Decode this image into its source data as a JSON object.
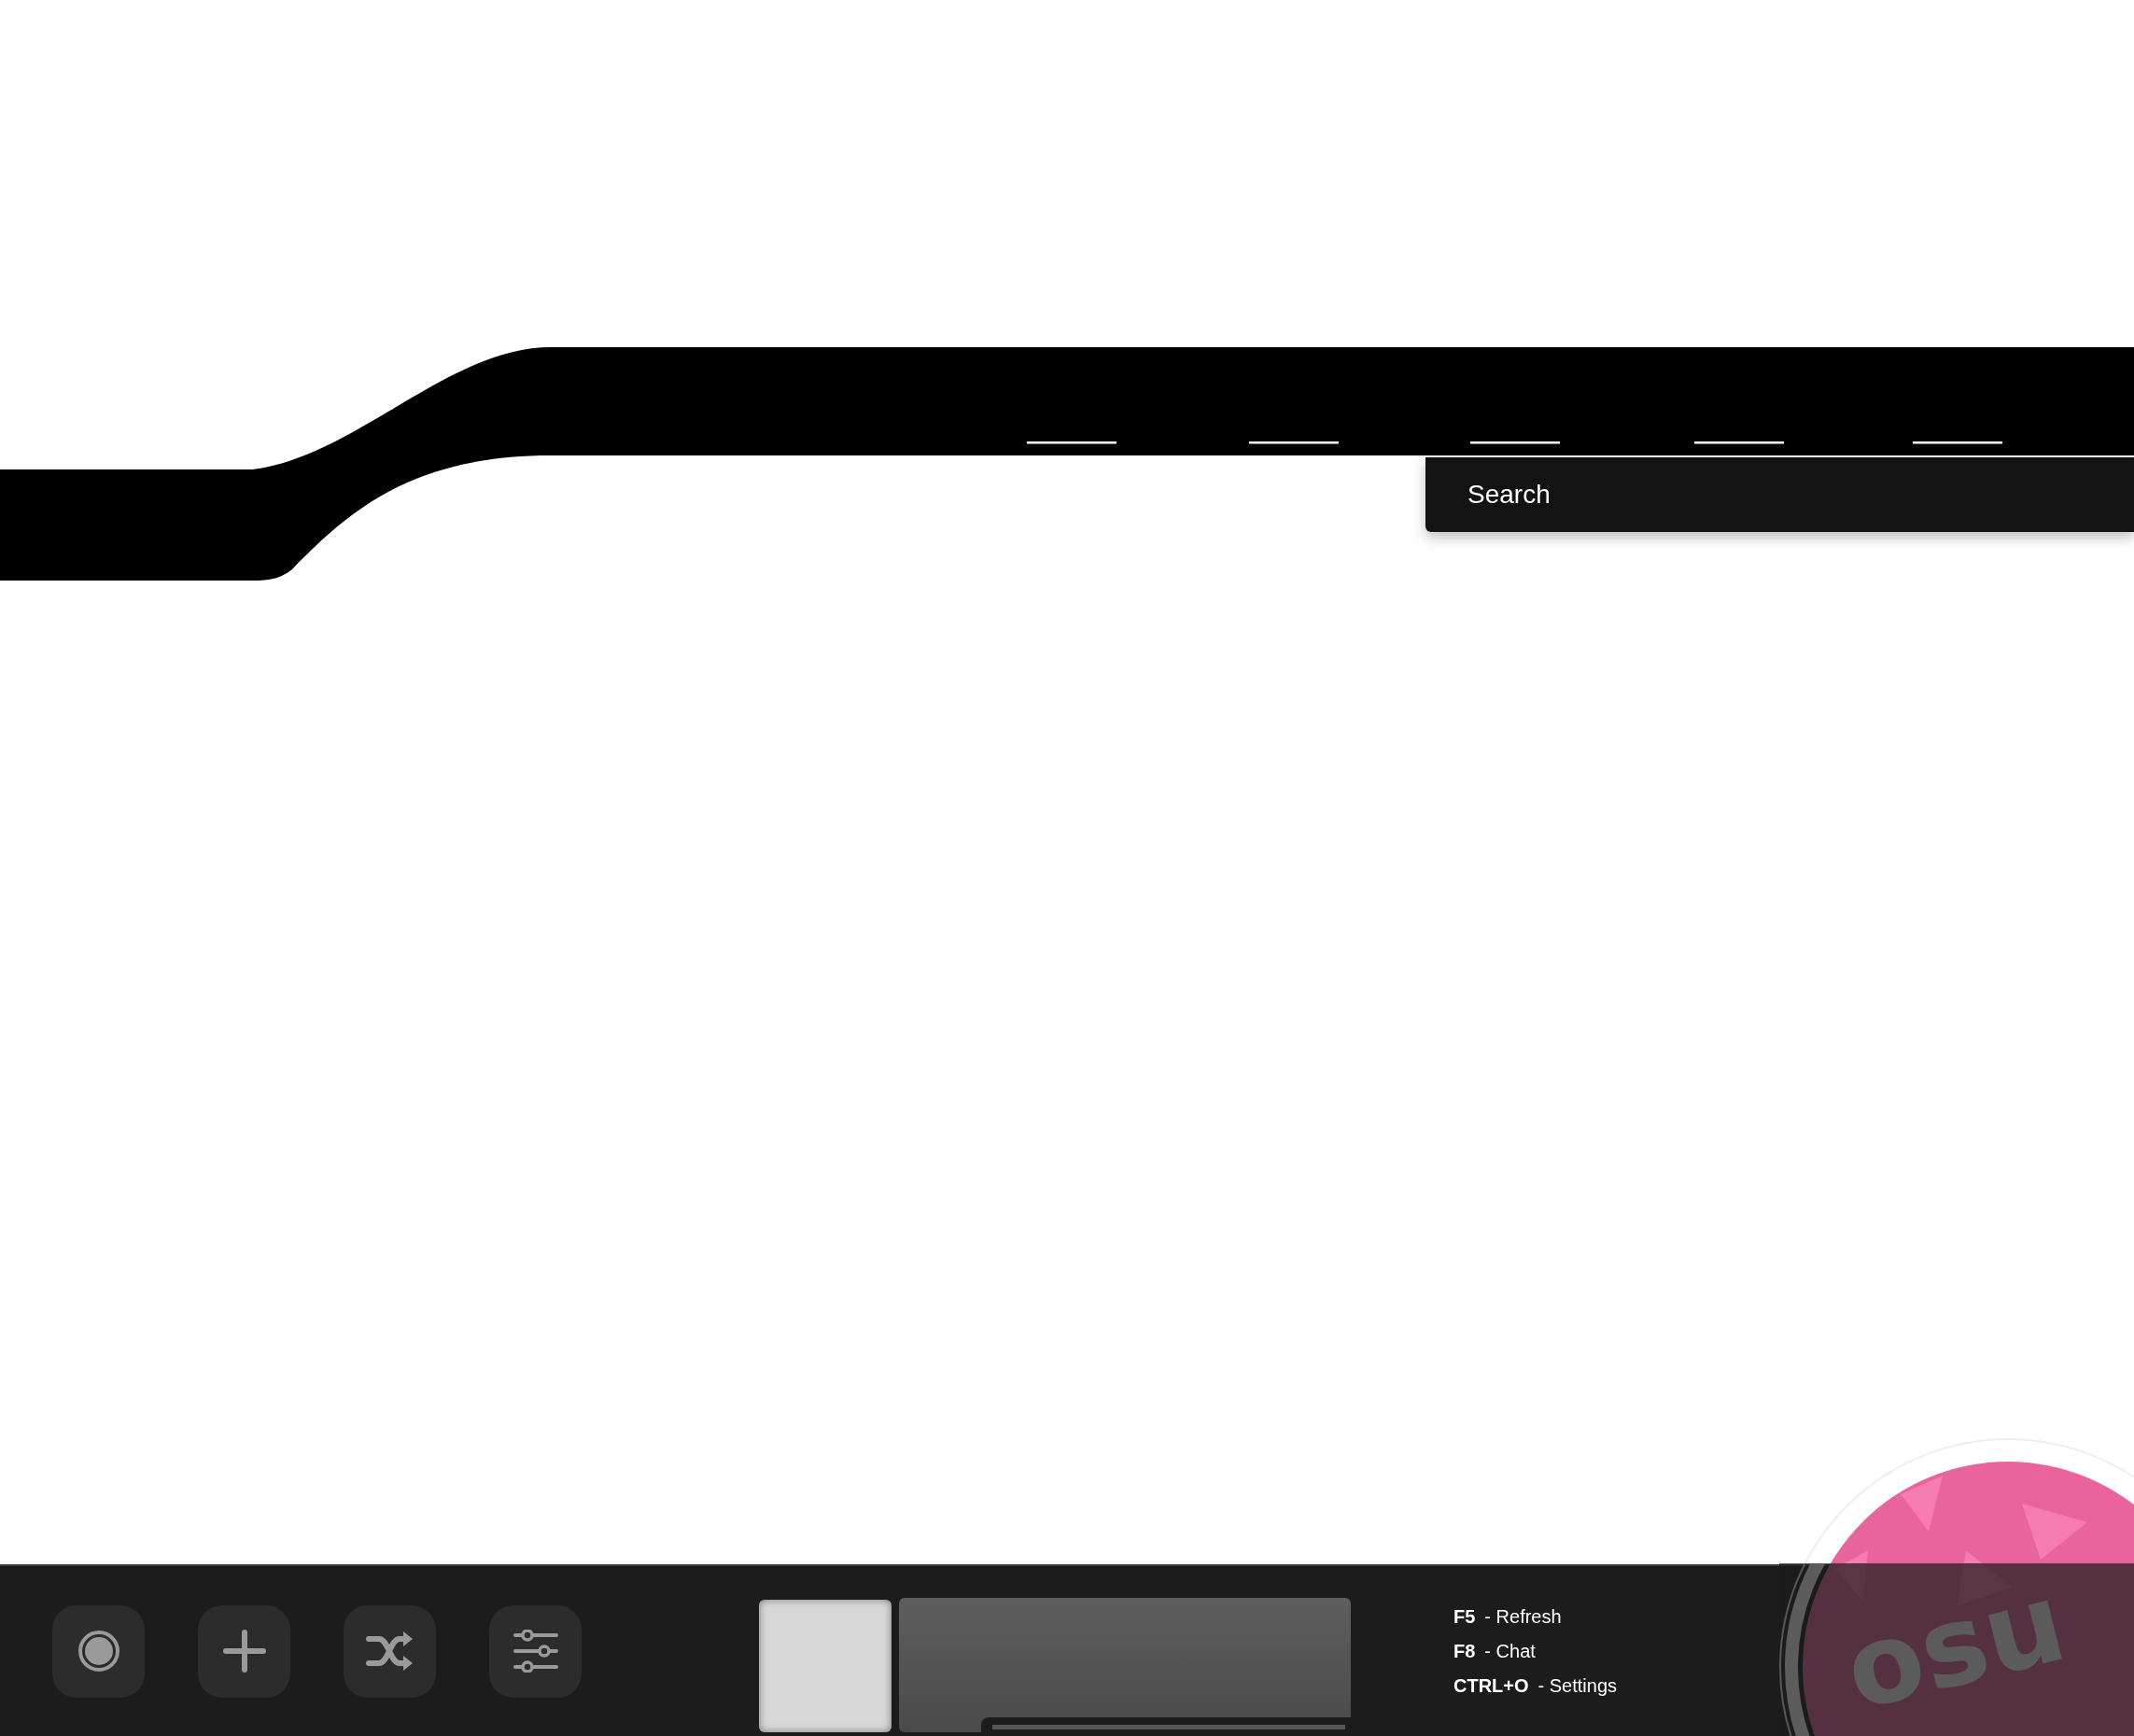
{
  "search": {
    "placeholder": "Search"
  },
  "toolbar": {
    "buttons": [
      {
        "kind": "circle"
      },
      {
        "kind": "plus"
      },
      {
        "kind": "shuffle"
      },
      {
        "kind": "sliders"
      }
    ]
  },
  "hotkeys": [
    {
      "key": "F5",
      "action": "- Refresh"
    },
    {
      "key": "F8",
      "action": "- Chat"
    },
    {
      "key": "CTRL+O",
      "action": "- Settings"
    }
  ],
  "logo": {
    "text": "osu"
  }
}
